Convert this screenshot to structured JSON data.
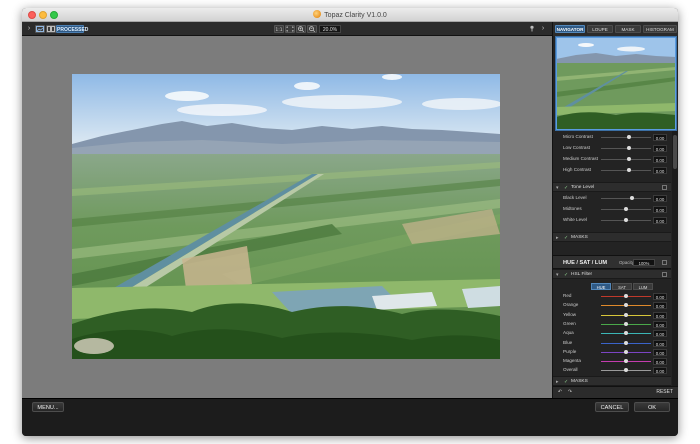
{
  "window": {
    "title": "Topaz Clarity V1.0.0"
  },
  "toolbar": {
    "processed_label": "PROCESSED",
    "zoom_value": "20.0%",
    "left_arrow": "›",
    "right_arrow": "›"
  },
  "panel": {
    "tabs": [
      {
        "label": "NAVIGATOR",
        "active": true
      },
      {
        "label": "LOUPE",
        "active": false
      },
      {
        "label": "MASK",
        "active": false
      },
      {
        "label": "HISTOGRAM",
        "active": false
      }
    ],
    "contrast_sliders": [
      {
        "label": "Micro Contrast",
        "value": "0.00",
        "pos": 0.55
      },
      {
        "label": "Low Contrast",
        "value": "0.00",
        "pos": 0.55
      },
      {
        "label": "Medium Contrast",
        "value": "0.00",
        "pos": 0.55
      },
      {
        "label": "High Contrast",
        "value": "0.00",
        "pos": 0.55
      }
    ],
    "tone_section": {
      "label": "Tone Level"
    },
    "tone_sliders": [
      {
        "label": "Black Level",
        "value": "0.00",
        "pos": 0.62
      },
      {
        "label": "Midtones",
        "value": "0.00",
        "pos": 0.5
      },
      {
        "label": "White Level",
        "value": "0.00",
        "pos": 0.5
      }
    ],
    "masks_label": "MASKS",
    "hsl_group": {
      "label": "HUE / SAT / LUM",
      "opacity_label": "Opacity",
      "opacity_value": "100%"
    },
    "hsl_filter": {
      "label": "HSL Filter",
      "tabs": [
        "HUE",
        "SAT",
        "LUM"
      ]
    },
    "hsl_sliders": [
      {
        "label": "Red",
        "value": "0.00",
        "color": "#c0392b",
        "pos": 0.5
      },
      {
        "label": "Orange",
        "value": "0.00",
        "color": "#e08a2b",
        "pos": 0.5
      },
      {
        "label": "Yellow",
        "value": "0.00",
        "color": "#d8c63a",
        "pos": 0.5
      },
      {
        "label": "Green",
        "value": "0.00",
        "color": "#4aa84a",
        "pos": 0.5
      },
      {
        "label": "Aqua",
        "value": "0.00",
        "color": "#3bb6b6",
        "pos": 0.5
      },
      {
        "label": "Blue",
        "value": "0.00",
        "color": "#3a63c9",
        "pos": 0.5
      },
      {
        "label": "Purple",
        "value": "0.00",
        "color": "#7b44c4",
        "pos": 0.5
      },
      {
        "label": "Magenta",
        "value": "0.00",
        "color": "#c43cae",
        "pos": 0.5
      },
      {
        "label": "Overall",
        "value": "0.00",
        "color": "#9a9a9a",
        "pos": 0.5
      }
    ],
    "masks_label_2": "MASKS",
    "reset_label": "RESET"
  },
  "bottom": {
    "menu_label": "MENU...",
    "cancel_label": "CANCEL",
    "ok_label": "OK"
  }
}
